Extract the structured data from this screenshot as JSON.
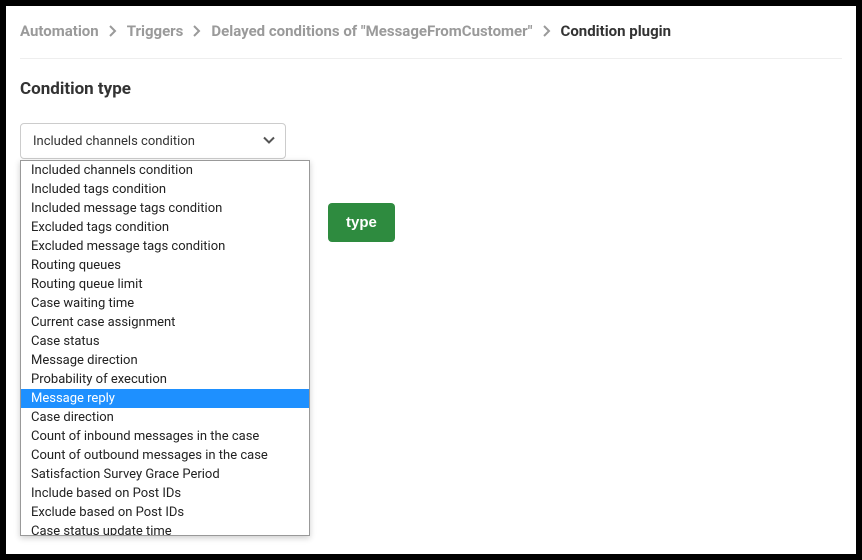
{
  "breadcrumb": {
    "items": [
      {
        "label": "Automation"
      },
      {
        "label": "Triggers"
      },
      {
        "label": "Delayed conditions of \"MessageFromCustomer\""
      },
      {
        "label": "Condition plugin"
      }
    ]
  },
  "section": {
    "title": "Condition type"
  },
  "select": {
    "selected": "Included channels condition",
    "highlighted_index": 12,
    "options": [
      "Included channels condition",
      "Included tags condition",
      "Included message tags condition",
      "Excluded tags condition",
      "Excluded message tags condition",
      "Routing queues",
      "Routing queue limit",
      "Case waiting time",
      "Current case assignment",
      "Case status",
      "Message direction",
      "Probability of execution",
      "Message reply",
      "Case direction",
      "Count of inbound messages in the case",
      "Count of outbound messages in the case",
      "Satisfaction Survey Grace Period",
      "Include based on Post IDs",
      "Exclude based on Post IDs",
      "Case status update time"
    ]
  },
  "button": {
    "label": "type"
  }
}
